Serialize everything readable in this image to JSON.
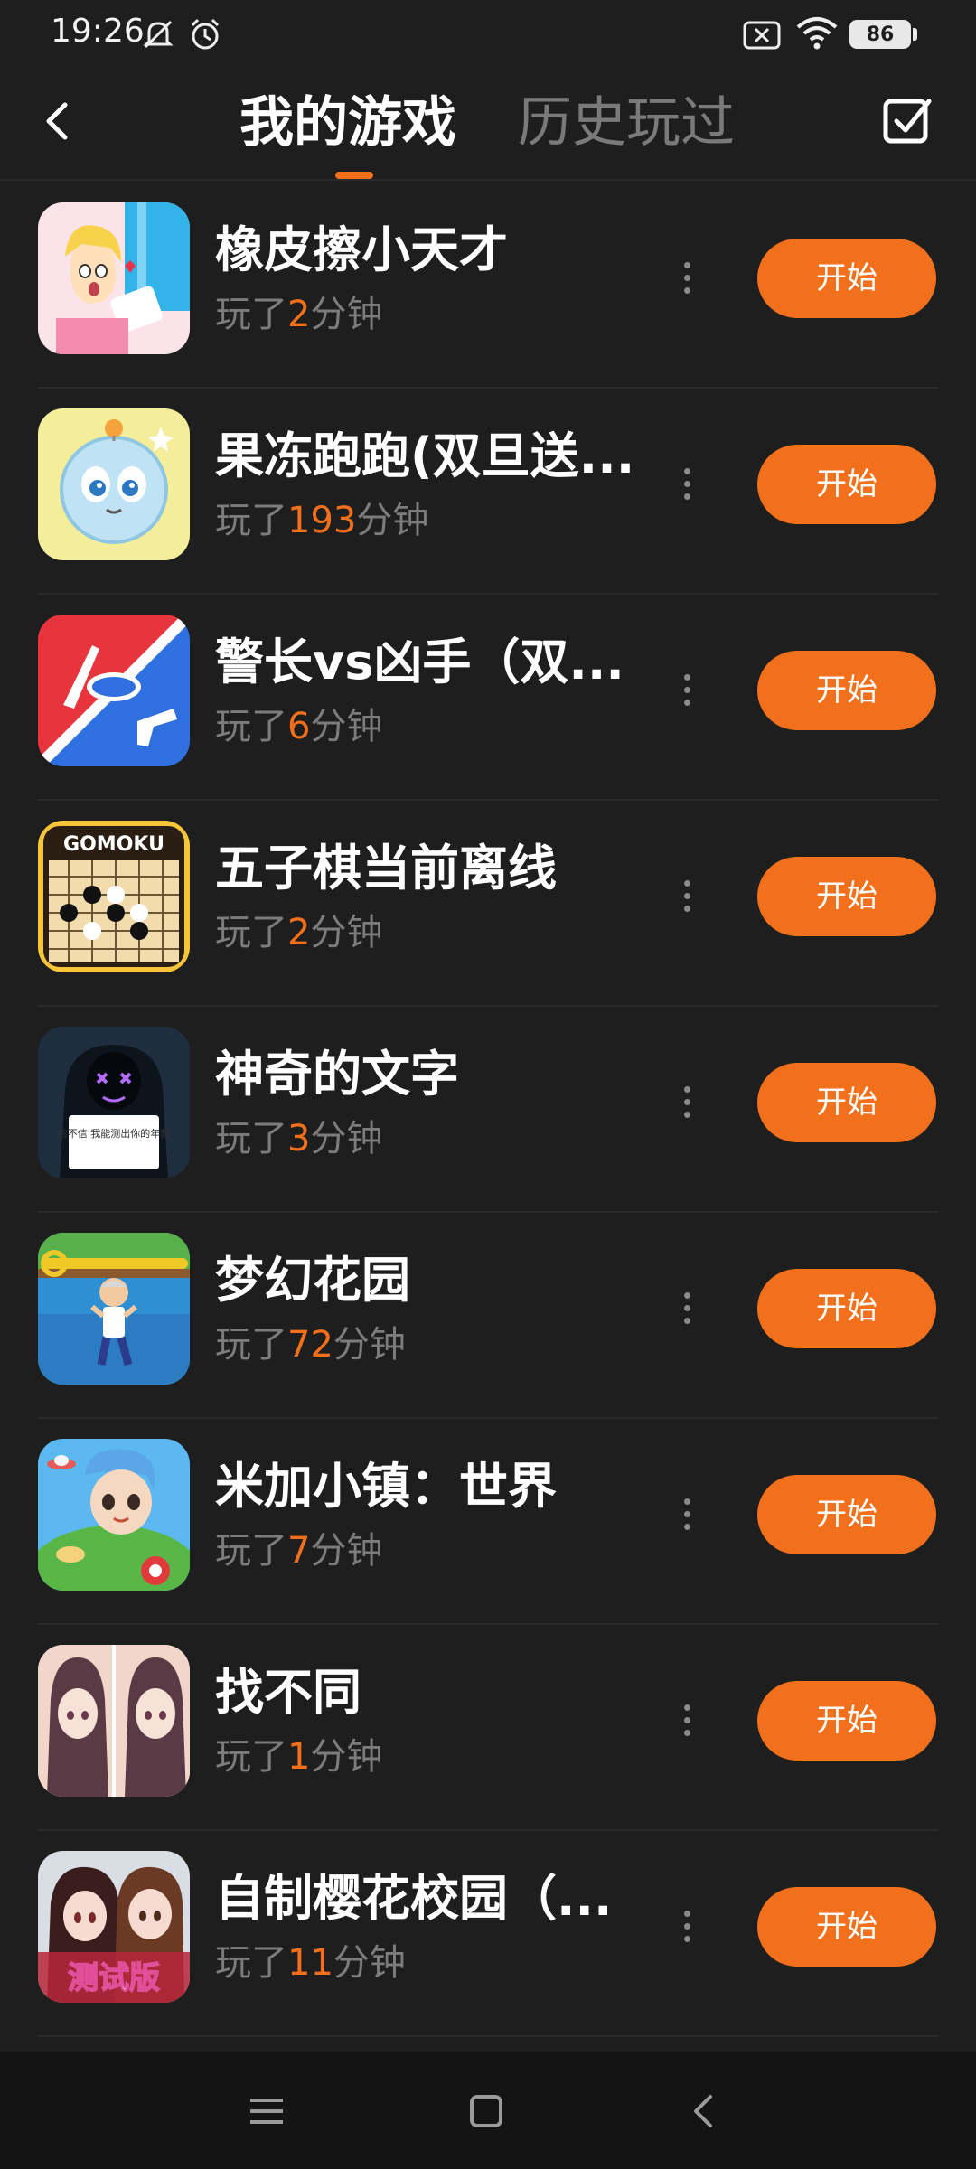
{
  "status_bar": {
    "time": "19:26",
    "battery": "86",
    "icons": [
      "mute-bell-icon",
      "alarm-clock-icon",
      "no-sim-icon",
      "wifi-icon",
      "battery-icon"
    ]
  },
  "header": {
    "tab_active": "我的游戏",
    "tab_inactive": "历史玩过",
    "back_icon": "chevron-left-icon",
    "manage_icon": "checkbox-icon",
    "accent_color": "#f26f1c"
  },
  "games": [
    {
      "title": "橡皮擦小天才",
      "played_prefix": "玩了",
      "minutes": "2",
      "played_suffix": "分钟",
      "button": "开始"
    },
    {
      "title": "果冻跑跑(双旦送...",
      "played_prefix": "玩了",
      "minutes": "193",
      "played_suffix": "分钟",
      "button": "开始"
    },
    {
      "title": "警长vs凶手（双...",
      "played_prefix": "玩了",
      "minutes": "6",
      "played_suffix": "分钟",
      "button": "开始"
    },
    {
      "title": "五子棋当前离线",
      "played_prefix": "玩了",
      "minutes": "2",
      "played_suffix": "分钟",
      "button": "开始",
      "icon_text": "GOMOKU"
    },
    {
      "title": "神奇的文字",
      "played_prefix": "玩了",
      "minutes": "3",
      "played_suffix": "分钟",
      "button": "开始",
      "icon_text": "信不信 我能测出你的年龄"
    },
    {
      "title": "梦幻花园",
      "played_prefix": "玩了",
      "minutes": "72",
      "played_suffix": "分钟",
      "button": "开始"
    },
    {
      "title": "米加小镇：世界",
      "played_prefix": "玩了",
      "minutes": "7",
      "played_suffix": "分钟",
      "button": "开始"
    },
    {
      "title": "找不同",
      "played_prefix": "玩了",
      "minutes": "1",
      "played_suffix": "分钟",
      "button": "开始"
    },
    {
      "title": "自制樱花校园（...",
      "played_prefix": "玩了",
      "minutes": "11",
      "played_suffix": "分钟",
      "button": "开始",
      "icon_text": "测试版"
    }
  ],
  "nav_bar": {
    "icons": [
      "menu-icon",
      "home-square-icon",
      "back-triangle-icon"
    ]
  }
}
